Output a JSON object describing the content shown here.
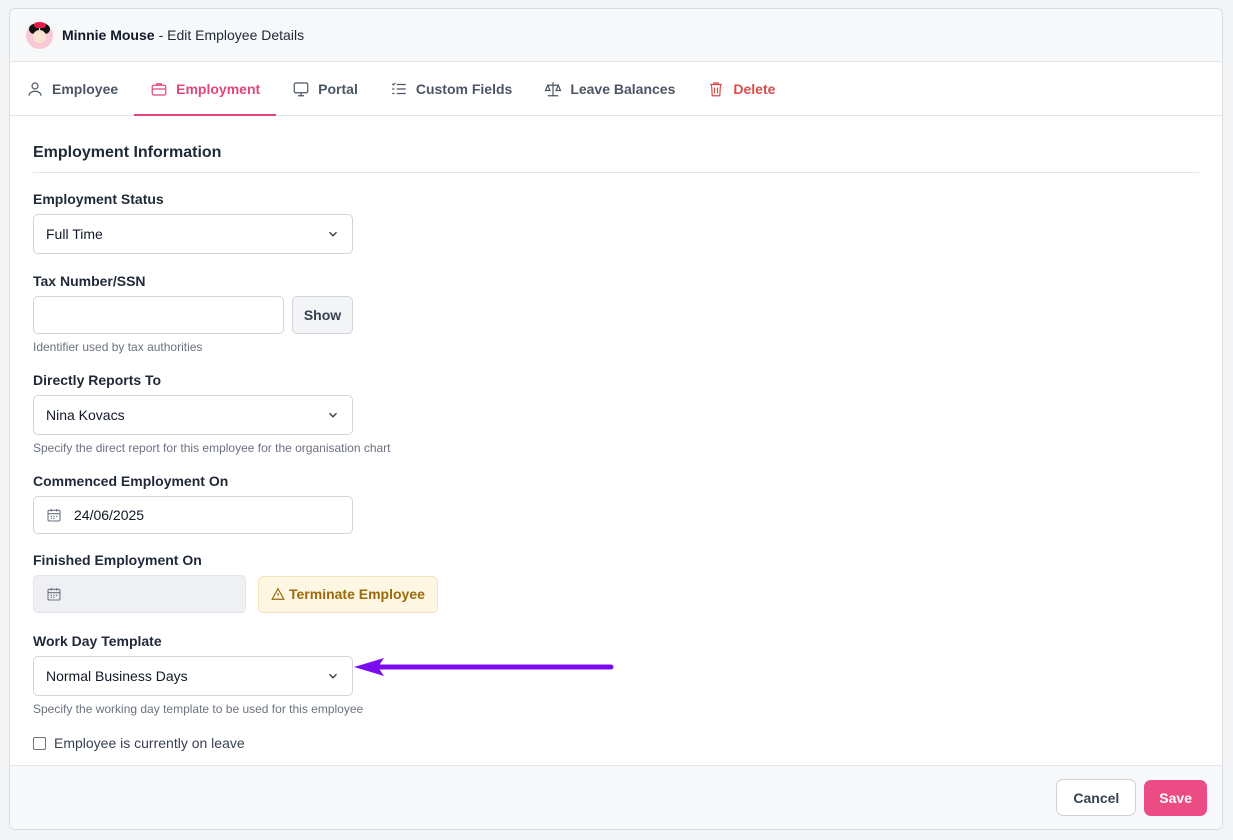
{
  "header": {
    "name": "Minnie Mouse",
    "subtitle": "- Edit Employee Details"
  },
  "tabs": [
    {
      "label": "Employee",
      "icon": "user-icon"
    },
    {
      "label": "Employment",
      "icon": "briefcase-icon",
      "active": true
    },
    {
      "label": "Portal",
      "icon": "monitor-icon"
    },
    {
      "label": "Custom Fields",
      "icon": "list-icon"
    },
    {
      "label": "Leave Balances",
      "icon": "scale-icon"
    },
    {
      "label": "Delete",
      "icon": "trash-icon"
    }
  ],
  "section": {
    "title": "Employment Information"
  },
  "fields": {
    "employment_status": {
      "label": "Employment Status",
      "value": "Full Time"
    },
    "tax_number": {
      "label": "Tax Number/SSN",
      "value": "",
      "show_label": "Show",
      "help": "Identifier used by tax authorities"
    },
    "reports_to": {
      "label": "Directly Reports To",
      "value": "Nina Kovacs",
      "help": "Specify the direct report for this employee for the organisation chart"
    },
    "commenced": {
      "label": "Commenced Employment On",
      "value": "24/06/2025"
    },
    "finished": {
      "label": "Finished Employment On",
      "value": "",
      "terminate_label": "Terminate Employee"
    },
    "work_day_template": {
      "label": "Work Day Template",
      "value": "Normal Business Days",
      "help": "Specify the working day template to be used for this employee"
    },
    "on_leave": {
      "label": "Employee is currently on leave",
      "checked": false
    }
  },
  "footer": {
    "cancel_label": "Cancel",
    "save_label": "Save"
  },
  "colors": {
    "accent": "#ec4c84",
    "arrow": "#7c0cf0",
    "danger": "#dc4b4b",
    "warning": "#9a6a0d"
  }
}
